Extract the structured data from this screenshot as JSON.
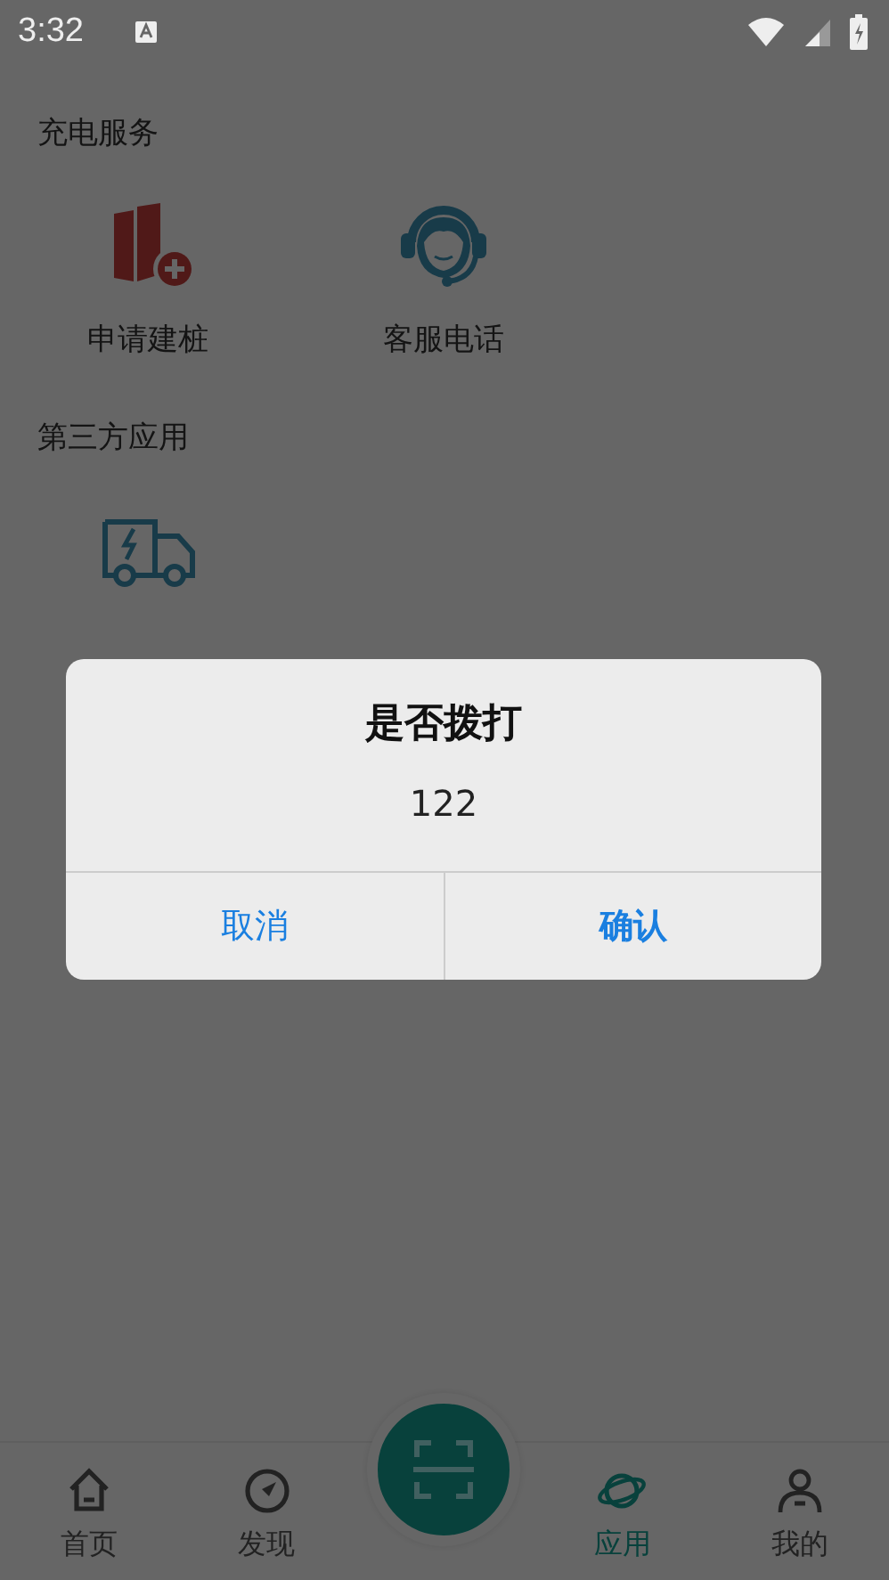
{
  "status_bar": {
    "time": "3:32"
  },
  "sections": [
    {
      "title": "充电服务",
      "items": [
        {
          "kind": "build",
          "label": "申请建桩"
        },
        {
          "kind": "service",
          "label": "客服电话"
        }
      ]
    },
    {
      "title": "第三方应用",
      "items": [
        {
          "kind": "truck"
        }
      ]
    }
  ],
  "dialog": {
    "title": "是否拨打",
    "message": "122",
    "buttons": [
      {
        "kind": "cancel",
        "label": "取消"
      },
      {
        "kind": "confirm",
        "label": "确认"
      }
    ]
  },
  "nav": [
    {
      "kind": "home",
      "label": "首页",
      "selected": false
    },
    {
      "kind": "discover",
      "label": "发现",
      "selected": false
    },
    {
      "kind": "scan"
    },
    {
      "kind": "apps",
      "label": "应用",
      "selected": true
    },
    {
      "kind": "profile",
      "label": "我的",
      "selected": false
    }
  ]
}
